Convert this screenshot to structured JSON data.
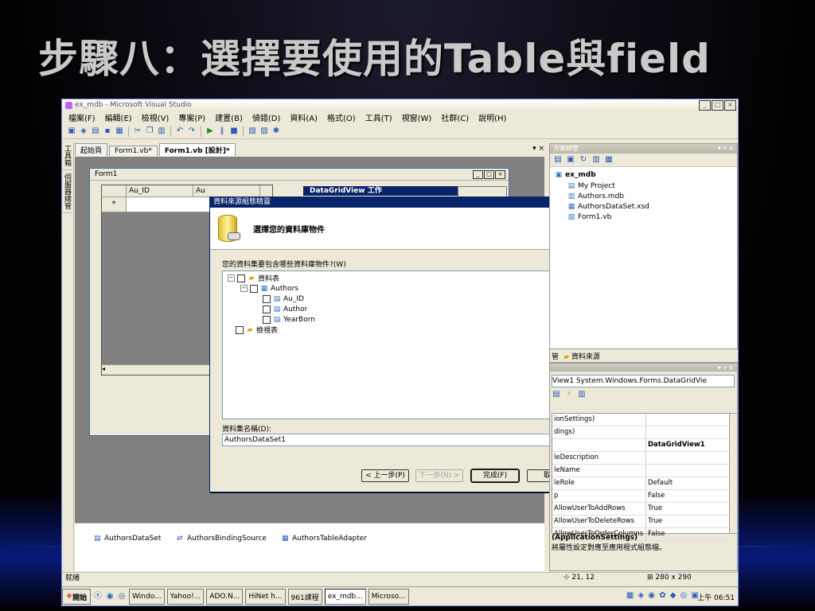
{
  "slide": {
    "title": "步驟八：選擇要使用的Table與field"
  },
  "window": {
    "title": "ex_mdb - Microsoft Visual Studio"
  },
  "menu": [
    "檔案(F)",
    "編輯(E)",
    "檢視(V)",
    "專案(P)",
    "建置(B)",
    "偵錯(D)",
    "資料(A)",
    "格式(O)",
    "工具(T)",
    "視窗(W)",
    "社群(C)",
    "說明(H)"
  ],
  "left_strip": [
    "工具箱",
    "伺服器總管"
  ],
  "doc_tabs": [
    "起始頁",
    "Form1.vb*",
    "Form1.vb [設計]*"
  ],
  "designer": {
    "form_title": "Form1",
    "grid_columns": [
      "Au_ID",
      "Au"
    ],
    "new_row_marker": "*",
    "smarttag_title": "DataGridView 工作"
  },
  "tray": [
    {
      "icon": "dataset-icon",
      "label": "AuthorsDataSet"
    },
    {
      "icon": "binding-source-icon",
      "label": "AuthorsBindingSource"
    },
    {
      "icon": "table-adapter-icon",
      "label": "AuthorsTableAdapter"
    }
  ],
  "wizard": {
    "title": "資料來源組態精靈",
    "heading": "選擇您的資料庫物件",
    "question": "您的資料集要包含哪些資料庫物件?(W)",
    "tree": {
      "tables": "資料表",
      "authors": "Authors",
      "fields": [
        "Au_ID",
        "Author",
        "YearBorn"
      ],
      "views": "檢視表"
    },
    "dataset_label": "資料集名稱(D):",
    "dataset_name": "AuthorsDataSet1",
    "buttons": {
      "back": "< 上一步(P)",
      "next": "下一步(N) >",
      "finish": "完成(F)",
      "cancel": "取消"
    }
  },
  "solution": {
    "title": "方案總管",
    "project": "ex_mdb",
    "items": [
      "My Project",
      "Authors.mdb",
      "AuthorsDataSet.xsd",
      "Form1.vb"
    ],
    "tab_suffix": "管",
    "tab_data": "資料來源"
  },
  "props": {
    "object": "View1  System.Windows.Forms.DataGridVie",
    "rows": [
      {
        "name": "ionSettings)",
        "value": ""
      },
      {
        "name": "dings)",
        "value": ""
      },
      {
        "name": "",
        "value": "DataGridView1"
      },
      {
        "name": "leDescription",
        "value": ""
      },
      {
        "name": "leName",
        "value": ""
      },
      {
        "name": "leRole",
        "value": "Default"
      },
      {
        "name": "p",
        "value": "False"
      },
      {
        "name": "AllowUserToAddRows",
        "value": "True"
      },
      {
        "name": "AllowUserToDeleteRows",
        "value": "True"
      },
      {
        "name": "AllowUserToOrderColumns",
        "value": "False"
      }
    ],
    "desc_title": "(ApplicationSettings)",
    "desc_text": "將屬性設定對應至應用程式組態檔。"
  },
  "status": {
    "text": "就緒",
    "position": "21, 12",
    "size": "280 x 290"
  },
  "taskbar": {
    "start": "開始",
    "items": [
      "Windo...",
      "Yahoo!...",
      "ADO.N...",
      "HiNet h...",
      "961課程",
      "ex_mdb...",
      "Microso..."
    ],
    "clock": "上午 06:51"
  }
}
